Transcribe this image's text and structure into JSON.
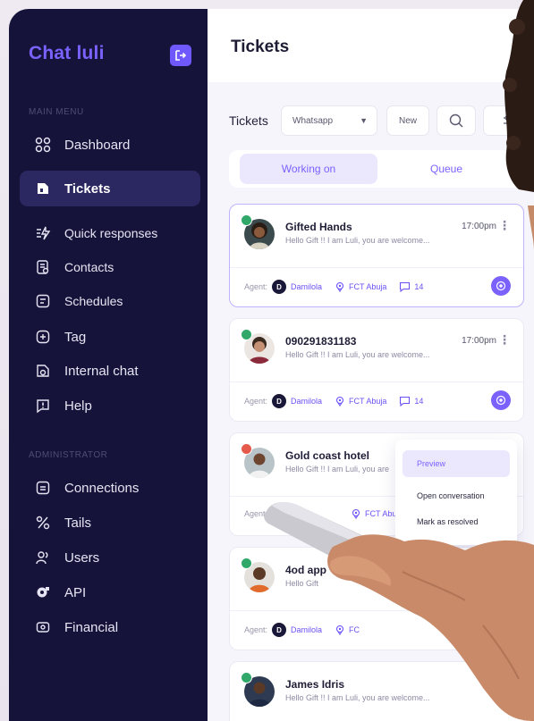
{
  "sidebar": {
    "brand": "Chat luli",
    "main_menu_label": "MAIN MENU",
    "admin_label": "ADMINISTRATOR",
    "main_items": [
      {
        "label": "Dashboard",
        "icon": "grid-icon"
      },
      {
        "label": "Tickets",
        "icon": "ticket-icon",
        "active": true
      },
      {
        "label": "Quick responses",
        "icon": "lightning-icon"
      },
      {
        "label": "Contacts",
        "icon": "contact-card-icon"
      },
      {
        "label": "Schedules",
        "icon": "calendar-icon"
      },
      {
        "label": "Tag",
        "icon": "tag-icon"
      },
      {
        "label": "Internal chat",
        "icon": "chat-icon"
      },
      {
        "label": "Help",
        "icon": "help-icon"
      }
    ],
    "admin_items": [
      {
        "label": "Connections",
        "icon": "link-icon"
      },
      {
        "label": "Tails",
        "icon": "percent-icon"
      },
      {
        "label": "Users",
        "icon": "users-icon"
      },
      {
        "label": "API",
        "icon": "api-icon"
      },
      {
        "label": "Financial",
        "icon": "money-icon"
      }
    ]
  },
  "header": {
    "title": "Tickets"
  },
  "toolbar": {
    "label": "Tickets",
    "channel_select": "Whatsapp",
    "new_label": "New"
  },
  "tabs": [
    {
      "label": "Working on",
      "active": true
    },
    {
      "label": "Queue"
    }
  ],
  "tickets": [
    {
      "name": "Gifted Hands",
      "message": "Hello Gift !! I am Luli, you are welcome...",
      "time": "17:00pm",
      "agent_label": "Agent:",
      "agent_initial": "D",
      "agent": "Damilola",
      "location": "FCT Abuja",
      "count": "14",
      "badge": "whatsapp"
    },
    {
      "name": "090291831183",
      "message": "Hello Gift !! I am Luli, you are welcome...",
      "time": "17:00pm",
      "agent_label": "Agent:",
      "agent_initial": "D",
      "agent": "Damilola",
      "location": "FCT Abuja",
      "count": "14",
      "badge": "whatsapp"
    },
    {
      "name": "Gold coast hotel",
      "message": "Hello Gift !! I am Luli, you are",
      "time": "",
      "agent_label": "Agent:",
      "agent_initial": "",
      "agent": "",
      "location": "FCT Abu",
      "count": "",
      "badge": "red"
    },
    {
      "name": "4od app",
      "message": "Hello Gift",
      "time": "",
      "agent_label": "Agent:",
      "agent_initial": "D",
      "agent": "Damilola",
      "location": "FC",
      "count": "",
      "badge": "whatsapp"
    },
    {
      "name": "James Idris",
      "message": "Hello Gift !! I am Luli, you are welcome...",
      "time": "",
      "agent_label": "",
      "agent_initial": "",
      "agent": "",
      "location": "",
      "count": "",
      "badge": "whatsapp"
    }
  ],
  "context_menu": [
    {
      "label": "Preview",
      "active": true
    },
    {
      "label": "Open conversation"
    },
    {
      "label": "Mark as resolved"
    }
  ],
  "colors": {
    "sidebar_bg": "#16133a",
    "accent": "#7b62ff",
    "active_item_bg": "#2b2760",
    "whatsapp": "#2fa86a"
  }
}
